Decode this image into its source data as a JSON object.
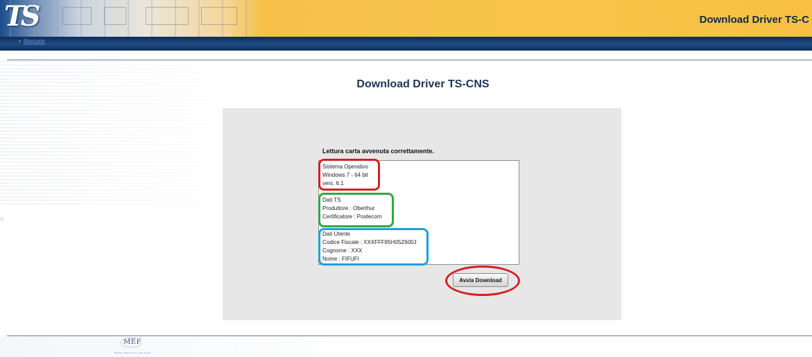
{
  "header": {
    "logo_text": "TS",
    "title": "Download Driver TS-C",
    "nav_link": "Manuale"
  },
  "main": {
    "title": "Download Driver TS-CNS",
    "status_message": "Lettura carta avvenuta correttamente.",
    "system_info": {
      "heading": "Sistema Operativo",
      "os": "Windows 7 - 64 bit",
      "version": "vers. 6.1"
    },
    "ts_info": {
      "heading": "Dati TS",
      "producer": "Produttore : Oberthur",
      "certifier": "Certificatore : Postecom"
    },
    "user_info": {
      "heading": "Dati Utente",
      "fiscal_code": "Codice Fiscale : XXXFFF85H05Z600J",
      "surname": "Cognome : XXX",
      "name": "Nome : FIFUFI"
    },
    "download_button": "Avvia Download"
  },
  "footer": {
    "logo_text": "MEF",
    "logo_caption": "Ministero dell'Economia e delle Finanze"
  },
  "colors": {
    "header_yellow": "#f6c24a",
    "navbar_blue": "#1e4a85",
    "title_blue": "#1b3555",
    "highlight_red": "#d31f26",
    "highlight_green": "#2eaa3f",
    "highlight_blue": "#1ea0d8"
  }
}
